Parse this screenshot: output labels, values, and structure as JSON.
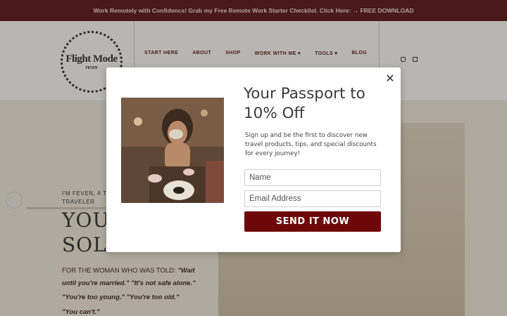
{
  "announcement": {
    "text": "Work Remotely with Confidence! Grab my Free Remote Work Starter Checklist. Click Here: → FREE DOWNLOAD"
  },
  "logo": {
    "title": "Flight Mode",
    "subtitle": "FEVEN"
  },
  "nav": {
    "items": [
      {
        "label": "START HERE"
      },
      {
        "label": "ABOUT"
      },
      {
        "label": "SHOP"
      },
      {
        "label": "WORK WITH ME ▾"
      },
      {
        "label": "TOOLS ▾"
      },
      {
        "label": "BLOG"
      }
    ]
  },
  "social": {
    "icons": [
      "instagram-icon",
      "linkedin-icon"
    ]
  },
  "hero": {
    "subtitle_line1": "I'M FEVEN, A TR",
    "subtitle_line2": "TRAVELER",
    "title_line1": "YOU",
    "title_line2": "SOLO",
    "body_line1_plain": "FOR THE WOMAN WHO WAS TOLD: ",
    "body_line1_bold": "\"Wait",
    "body_line2": "until you're married.\" \"It's not safe alone.\"",
    "body_line3": "\"You're too young.\" \"You're too old.\"",
    "body_line4": "\"You can't.\""
  },
  "popup": {
    "title": "Your Passport to 10% Off",
    "description": "Sign up and be the first to discover new travel products, tips, and special discounts for every journey!",
    "name_placeholder": "Name",
    "email_placeholder": "Email Address",
    "submit_label": "SEND IT NOW",
    "close_label": "✕"
  },
  "colors": {
    "brand": "#5b1214",
    "button": "#6e0707",
    "overlay": "rgba(40,40,40,0.32)"
  }
}
